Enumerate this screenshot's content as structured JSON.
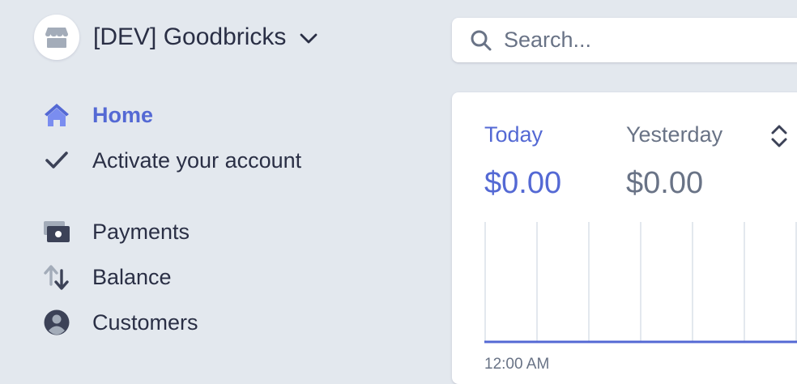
{
  "account": {
    "name": "[DEV] Goodbricks",
    "logo_icon": "store-icon",
    "menu_icon": "chevron-down-icon"
  },
  "search": {
    "placeholder": "Search..."
  },
  "nav": {
    "items": [
      {
        "label": "Home",
        "icon": "home-icon",
        "active": true
      },
      {
        "label": "Activate your account",
        "icon": "check-icon",
        "active": false
      },
      {
        "label": "Payments",
        "icon": "payments-icon",
        "active": false
      },
      {
        "label": "Balance",
        "icon": "arrows-up-down-icon",
        "active": false
      },
      {
        "label": "Customers",
        "icon": "customer-icon",
        "active": false
      }
    ]
  },
  "overview": {
    "today_label": "Today",
    "today_value": "$0.00",
    "yesterday_label": "Yesterday",
    "yesterday_value": "$0.00",
    "compare_icon": "chevron-up-down-icon",
    "chart_start_label": "12:00 AM"
  },
  "colors": {
    "accent": "#5469d4",
    "text": "#2a2f45",
    "muted": "#697386",
    "background": "#e3e8ee"
  }
}
